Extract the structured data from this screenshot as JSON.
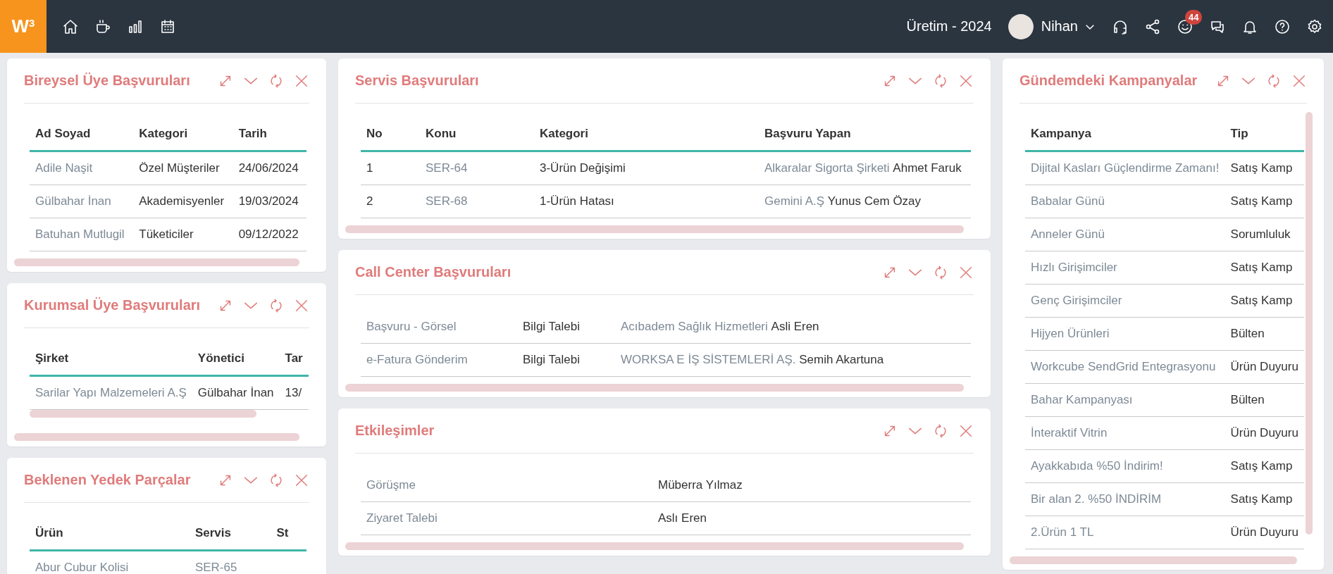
{
  "topbar": {
    "logo": "W$^{3}$",
    "period": "Üretim - 2024",
    "user": "Nihan",
    "notification_count": "44"
  },
  "columns": [
    {
      "panels": [
        {
          "title": "Bireysel Üye Başvuruları",
          "bottom_scrollbar": true,
          "table_scrollbar": false,
          "vertical_scrollbar": false,
          "columns": [
            "Ad Soyad",
            "Kategori",
            "Tarih"
          ],
          "rows": [
            [
              {
                "kind": "link",
                "text": "Adile Naşit"
              },
              {
                "kind": "text",
                "text": "Özel Müşteriler"
              },
              {
                "kind": "text",
                "text": "24/06/2024"
              }
            ],
            [
              {
                "kind": "link",
                "text": "Gülbahar İnan"
              },
              {
                "kind": "text",
                "text": "Akademisyenler"
              },
              {
                "kind": "text",
                "text": "19/03/2024"
              }
            ],
            [
              {
                "kind": "link",
                "text": "Batuhan Mutlugil"
              },
              {
                "kind": "text",
                "text": "Tüketiciler"
              },
              {
                "kind": "text",
                "text": "09/12/2022"
              }
            ]
          ]
        },
        {
          "title": "Kurumsal Üye Başvuruları",
          "bottom_scrollbar": true,
          "table_scrollbar": true,
          "vertical_scrollbar": false,
          "columns": [
            "Şirket",
            "Yönetici",
            "Tar"
          ],
          "rows": [
            [
              {
                "kind": "link",
                "text": "Sarilar Yapı Malzemeleri A.Ş"
              },
              {
                "kind": "text",
                "text": "Gülbahar İnan"
              },
              {
                "kind": "text",
                "text": "13/"
              }
            ]
          ]
        },
        {
          "title": "Beklenen Yedek Parçalar",
          "bottom_scrollbar": false,
          "table_scrollbar": false,
          "vertical_scrollbar": false,
          "columns": [
            "Ürün",
            "Servis",
            "St"
          ],
          "rows": [
            [
              {
                "kind": "link",
                "text": "Abur Cubur Kolisi"
              },
              {
                "kind": "link",
                "text": "SER-65"
              }
            ]
          ]
        }
      ]
    },
    {
      "panels": [
        {
          "title": "Servis Başvuruları",
          "bottom_scrollbar": true,
          "table_scrollbar": false,
          "vertical_scrollbar": false,
          "columns": [
            "No",
            "Konu",
            "Kategori",
            "Başvuru Yapan"
          ],
          "rows": [
            [
              {
                "kind": "text",
                "text": "1"
              },
              {
                "kind": "link",
                "text": "SER-64"
              },
              {
                "kind": "text",
                "text": "3-Ürün Değişimi"
              },
              {
                "kind": "applicant",
                "company": "Alkaralar Sigorta Şirketi",
                "person": "Ahmet Faruk"
              }
            ],
            [
              {
                "kind": "text",
                "text": "2"
              },
              {
                "kind": "link",
                "text": "SER-68"
              },
              {
                "kind": "text",
                "text": "1-Ürün Hatası"
              },
              {
                "kind": "applicant",
                "company": "Gemini A.Ş",
                "person": "Yunus Cem Özay"
              }
            ]
          ]
        },
        {
          "title": "Call Center Başvuruları",
          "bottom_scrollbar": true,
          "table_scrollbar": false,
          "vertical_scrollbar": false,
          "rows": [
            [
              {
                "kind": "link",
                "text": "Başvuru - Görsel"
              },
              {
                "kind": "text",
                "text": "Bilgi Talebi"
              },
              {
                "kind": "applicant",
                "company": "Acıbadem Sağlık Hizmetleri",
                "person": "Asli Eren"
              }
            ],
            [
              {
                "kind": "link",
                "text": "e-Fatura Gönderim"
              },
              {
                "kind": "text",
                "text": "Bilgi Talebi"
              },
              {
                "kind": "applicant",
                "company": "WORKSA E İŞ SİSTEMLERİ AŞ.",
                "person": "Semih Akartuna"
              }
            ]
          ]
        },
        {
          "title": "Etkileşimler",
          "bottom_scrollbar": true,
          "table_scrollbar": false,
          "vertical_scrollbar": false,
          "rows": [
            [
              {
                "kind": "link",
                "text": "Görüşme"
              },
              {
                "kind": "text",
                "text": "Müberra Yılmaz"
              }
            ],
            [
              {
                "kind": "link",
                "text": "Ziyaret Talebi"
              },
              {
                "kind": "text",
                "text": "Aslı Eren"
              }
            ]
          ]
        }
      ]
    },
    {
      "panels": [
        {
          "title": "Gündemdeki Kampanyalar",
          "bottom_scrollbar": true,
          "table_scrollbar": false,
          "vertical_scrollbar": true,
          "columns": [
            "Kampanya",
            "Tip"
          ],
          "rows": [
            [
              {
                "kind": "link",
                "text": "Dijital Kasları Güçlendirme Zamanı!"
              },
              {
                "kind": "text",
                "text": "Satış Kamp"
              }
            ],
            [
              {
                "kind": "link",
                "text": "Babalar Günü"
              },
              {
                "kind": "text",
                "text": "Satış Kamp"
              }
            ],
            [
              {
                "kind": "link",
                "text": "Anneler Günü"
              },
              {
                "kind": "text",
                "text": "Sorumluluk"
              }
            ],
            [
              {
                "kind": "link",
                "text": "Hızlı Girişimciler"
              },
              {
                "kind": "text",
                "text": "Satış Kamp"
              }
            ],
            [
              {
                "kind": "link",
                "text": "Genç Girişimciler"
              },
              {
                "kind": "text",
                "text": "Satış Kamp"
              }
            ],
            [
              {
                "kind": "link",
                "text": "Hijyen Ürünleri"
              },
              {
                "kind": "text",
                "text": "Bülten"
              }
            ],
            [
              {
                "kind": "link",
                "text": "Workcube SendGrid Entegrasyonu"
              },
              {
                "kind": "text",
                "text": "Ürün Duyuru"
              }
            ],
            [
              {
                "kind": "link",
                "text": "Bahar Kampanyası"
              },
              {
                "kind": "text",
                "text": "Bülten"
              }
            ],
            [
              {
                "kind": "link",
                "text": "İnteraktif Vitrin"
              },
              {
                "kind": "text",
                "text": "Ürün Duyuru"
              }
            ],
            [
              {
                "kind": "link",
                "text": "Ayakkabıda %50 İndirim!"
              },
              {
                "kind": "text",
                "text": "Satış Kamp"
              }
            ],
            [
              {
                "kind": "link",
                "text": "Bir alan 2. %50 İNDİRİM"
              },
              {
                "kind": "text",
                "text": "Satış Kamp"
              }
            ],
            [
              {
                "kind": "link",
                "text": "2.Ürün 1 TL"
              },
              {
                "kind": "text",
                "text": "Ürün Duyuru"
              }
            ]
          ]
        }
      ]
    }
  ]
}
